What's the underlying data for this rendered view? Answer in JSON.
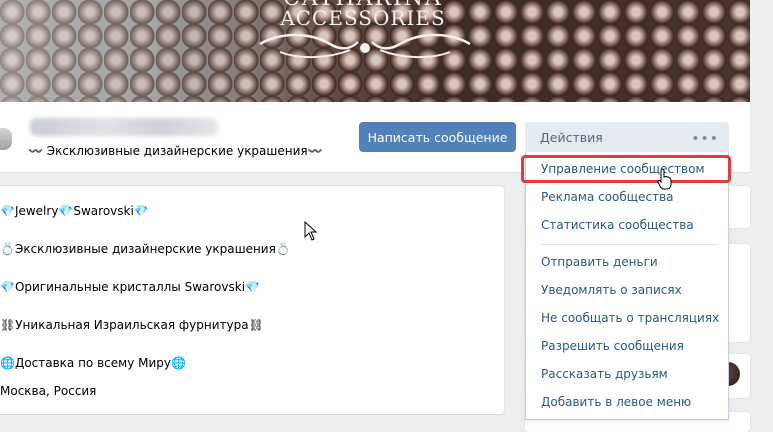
{
  "cover": {
    "brand_partial": "CATHARINA",
    "brand": "ACCESSORIES"
  },
  "header": {
    "status": "〰️ Эксклюзивные дизайнерские украшения〰️",
    "message_button": "Написать сообщение",
    "actions_button": "Действия",
    "actions_dots": "•••"
  },
  "info": {
    "lines": [
      "💎Jewelry💎Swarovski💎",
      "💍Эксклюзивные дизайнерские украшения💍",
      "💎Оригинальные кристаллы Swarovski💎",
      "⛓Уникальная Израильская фурнитура⛓",
      "🌐Доставка по всему Миру🌐",
      "Москва, Россия"
    ]
  },
  "menu": {
    "items": [
      "Управление сообществом",
      "Реклама сообщества",
      "Статистика сообщества",
      "Отправить деньги",
      "Уведомлять о записях",
      "Не сообщать о трансляциях",
      "Разрешить сообщения",
      "Рассказать друзьям",
      "Добавить в левое меню"
    ],
    "highlighted_index": 0
  },
  "colors": {
    "accent": "#5181b8",
    "link": "#2a5885",
    "highlight": "#e03c3c"
  }
}
